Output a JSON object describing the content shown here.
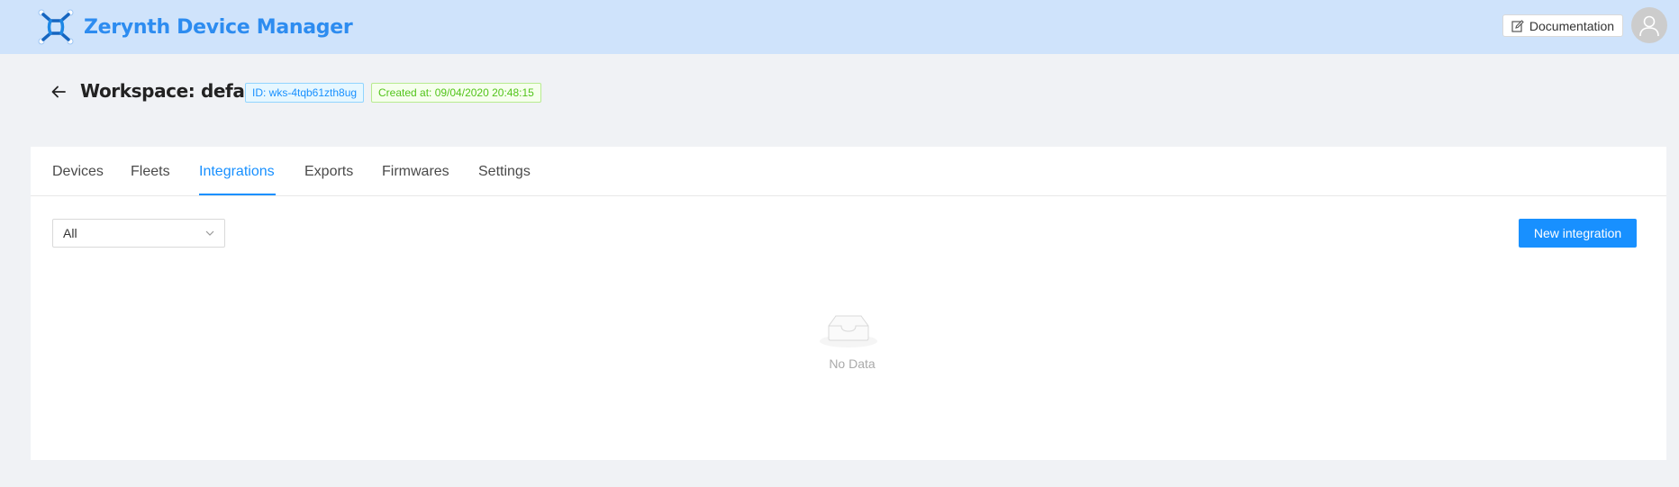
{
  "header": {
    "app_name": "Zerynth Device Manager",
    "documentation_label": "Documentation"
  },
  "page": {
    "title": "Workspace: default",
    "id_tag": "ID: wks-4tqb61zth8ug",
    "created_tag": "Created at: 09/04/2020 20:48:15"
  },
  "tabs": [
    {
      "label": "Devices"
    },
    {
      "label": "Fleets"
    },
    {
      "label": "Integrations"
    },
    {
      "label": "Exports"
    },
    {
      "label": "Firmwares"
    },
    {
      "label": "Settings"
    }
  ],
  "active_tab": "Integrations",
  "filter": {
    "selected": "All"
  },
  "new_button_label": "New integration",
  "empty_state": {
    "text": "No Data"
  },
  "colors": {
    "header_bg": "#cfe3fb",
    "brand": "#2d8cf0",
    "accent": "#1890ff",
    "success": "#52c41a"
  }
}
